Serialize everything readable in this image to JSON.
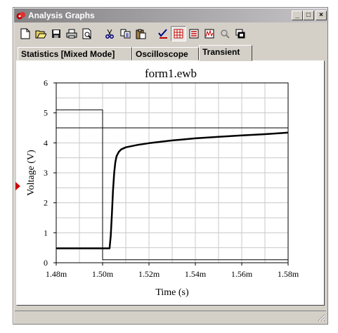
{
  "window": {
    "title": "Analysis Graphs"
  },
  "window_buttons": [
    "minimize",
    "maximize",
    "close"
  ],
  "toolbar": {
    "buttons": [
      {
        "name": "new-icon",
        "pressed": false
      },
      {
        "name": "open-icon",
        "pressed": false
      },
      {
        "name": "save-icon",
        "pressed": false
      },
      {
        "name": "print-icon",
        "pressed": false
      },
      {
        "name": "print-preview-icon",
        "pressed": false
      },
      {
        "name": "cut-icon",
        "pressed": false
      },
      {
        "name": "copy-icon",
        "pressed": false
      },
      {
        "name": "paste-icon",
        "pressed": false
      },
      {
        "name": "cursor-toggle-icon",
        "pressed": false
      },
      {
        "name": "grid-toggle-icon",
        "pressed": true
      },
      {
        "name": "legend-toggle-icon",
        "pressed": false
      },
      {
        "name": "properties-icon",
        "pressed": false
      },
      {
        "name": "zoom-icon",
        "pressed": false
      },
      {
        "name": "restore-graph-icon",
        "pressed": false
      }
    ]
  },
  "tabs": [
    {
      "label": "Statistics [Mixed Mode]",
      "active": false
    },
    {
      "label": "Oscilloscope",
      "active": false
    },
    {
      "label": "Transient",
      "active": true
    }
  ],
  "colors": {
    "accent": "#cc0000",
    "grid": "#c8c8c8",
    "face": "#d4d0c8"
  },
  "chart_data": {
    "type": "line",
    "title": "form1.ewb",
    "xlabel": "Time (s)",
    "ylabel": "Voltage (V)",
    "xlim": [
      0.00148,
      0.00158
    ],
    "ylim": [
      0,
      6
    ],
    "x_ticks": [
      0.00148,
      0.0015,
      0.00152,
      0.00154,
      0.00156,
      0.00158
    ],
    "x_tick_labels": [
      "1.48m",
      "1.50m",
      "1.52m",
      "1.54m",
      "1.56m",
      "1.58m"
    ],
    "y_ticks": [
      0,
      1,
      2,
      3,
      4,
      5,
      6
    ],
    "y_tick_labels": [
      "0",
      "1",
      "2",
      "3",
      "4",
      "5",
      "6"
    ],
    "grid": true,
    "series": [
      {
        "width": 1,
        "x": [
          0.00148,
          0.0015,
          0.0015,
          0.00158
        ],
        "y": [
          5.1,
          5.1,
          0.1,
          0.1
        ]
      },
      {
        "width": 1,
        "x": [
          0.00148,
          0.00158
        ],
        "y": [
          4.5,
          4.5
        ]
      },
      {
        "width": 2.5,
        "x": [
          0.00148,
          0.001503,
          0.0015035,
          0.001504,
          0.0015045,
          0.001505,
          0.0015055,
          0.001506,
          0.001507,
          0.001508,
          0.00151,
          0.001515,
          0.00152,
          0.00153,
          0.00154,
          0.00155,
          0.00156,
          0.00157,
          0.00158
        ],
        "y": [
          0.48,
          0.48,
          0.9,
          1.6,
          2.4,
          3.0,
          3.35,
          3.55,
          3.7,
          3.78,
          3.85,
          3.93,
          3.99,
          4.08,
          4.15,
          4.2,
          4.25,
          4.29,
          4.34
        ]
      }
    ]
  }
}
